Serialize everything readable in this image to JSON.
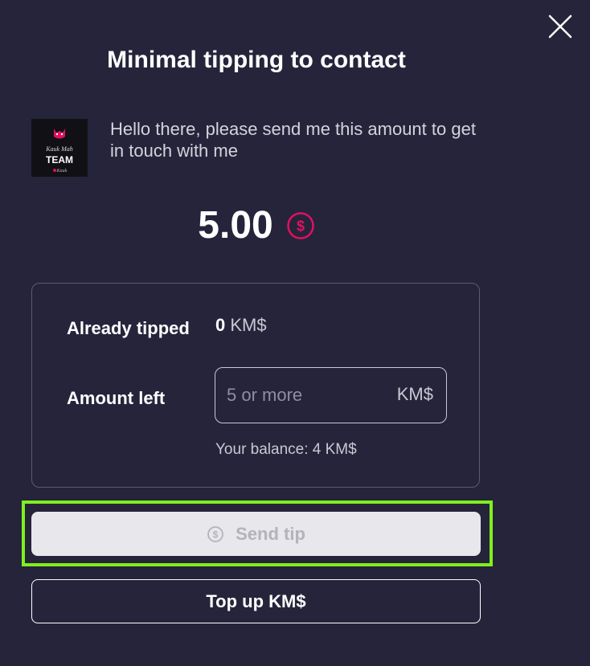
{
  "dialog": {
    "title": "Minimal tipping to contact",
    "message": "Hello there, please send me this amount to get in touch with me"
  },
  "avatar": {
    "lines": [
      "Kauk Mah",
      "TEAM",
      "Kauk"
    ]
  },
  "amount": {
    "value": "5.00",
    "currency_icon": "dollar-coin-icon"
  },
  "details": {
    "already_tipped_label": "Already tipped",
    "already_tipped_value": "0",
    "already_tipped_unit": "KM$",
    "amount_left_label": "Amount left",
    "amount_left_placeholder": "5 or more",
    "amount_left_value": "",
    "amount_left_unit": "KM$",
    "balance_text": "Your balance: 4 KM$"
  },
  "actions": {
    "send_tip_label": "Send tip",
    "top_up_label": "Top up KM$"
  },
  "colors": {
    "background": "#26243b",
    "accent": "#e0115f",
    "highlight": "#7ff01e",
    "disabled_button": "#e8e7eb"
  }
}
